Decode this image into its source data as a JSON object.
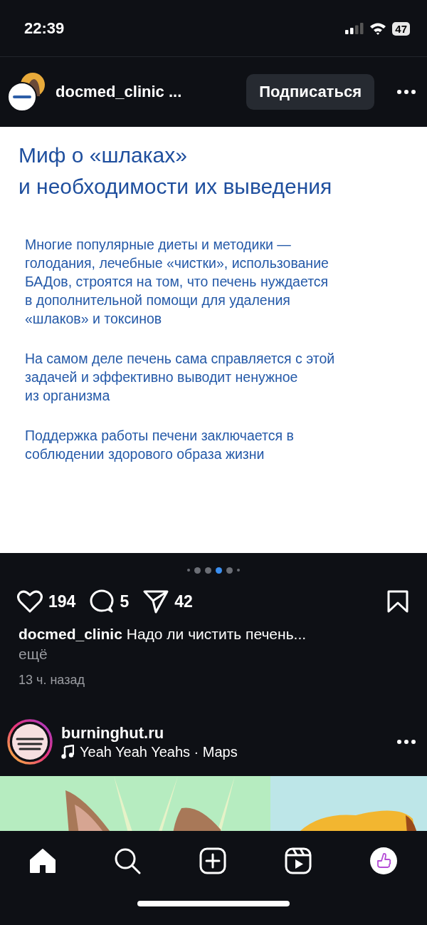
{
  "status_bar": {
    "time": "22:39",
    "battery": "47"
  },
  "post": {
    "username": "docmed_clinic ...",
    "follow_button": "Подписаться",
    "slide": {
      "title_lines": [
        "Миф о «шлаках»",
        "и необходимости их выведения"
      ],
      "paragraphs": [
        [
          "Многие популярные диеты и методики —",
          "голодания, лечебные «чистки», использование",
          "БАДов, строятся на том, что печень нуждается",
          "в дополнительной помощи для удаления",
          "«шлаков» и токсинов"
        ],
        [
          "На самом деле печень сама справляется с этой",
          "задачей и эффективно выводит ненужное",
          "из организма"
        ],
        [
          "Поддержка работы печени заключается в",
          "соблюдении здорового образа жизни"
        ]
      ]
    },
    "carousel_dots": [
      {
        "selected": false
      },
      {
        "selected": false
      },
      {
        "selected": false
      },
      {
        "selected": true
      },
      {
        "selected": false
      },
      {
        "selected": false
      }
    ],
    "likes": "194",
    "comments": "5",
    "shares": "42",
    "caption": "**docmed_clinic** Надо ли чистить печень...",
    "more": "ещё",
    "time_ago": "13 ч. назад"
  },
  "next_post": {
    "username": "burninghut.ru",
    "audio": "Yeah Yeah Yeahs · Maps"
  },
  "tab_bar": [
    {
      "kind": "home",
      "selected": true
    },
    {
      "kind": "search",
      "selected": false
    },
    {
      "kind": "create",
      "selected": false
    },
    {
      "kind": "reels",
      "selected": false
    },
    {
      "kind": "profile",
      "selected": false
    }
  ]
}
